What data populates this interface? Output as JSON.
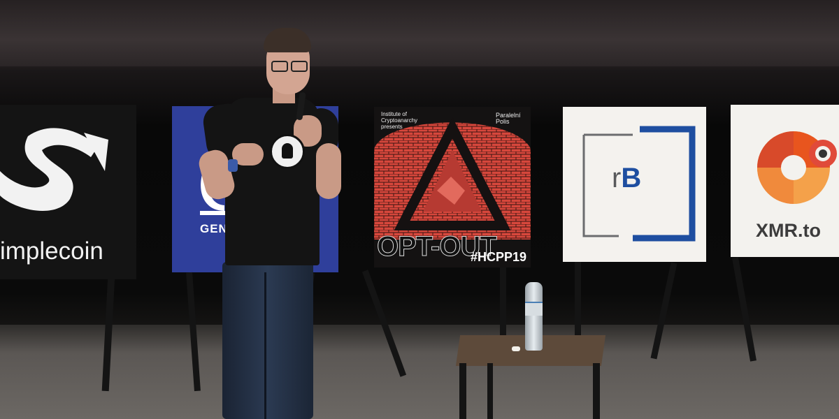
{
  "signs": {
    "simplecoin": {
      "wordmark": "implecoin",
      "color": "#141414"
    },
    "genesis": {
      "partial_text": "GEN",
      "color": "#2f3f9b"
    },
    "optout": {
      "presenter_left": "Institute of Cryptoanarchy",
      "presents": "presents",
      "presenter_right": "Paralelní Polis",
      "title": "OPT-OUT",
      "hashtag": "#HCPP19",
      "accent": "#d7473c"
    },
    "rb": {
      "letters_r": "r",
      "letters_b": "B",
      "accent": "#1e4ea0"
    },
    "xmr": {
      "wordmark": "XMR.to",
      "accent": "#e8551e"
    }
  },
  "scene": {
    "shirt_badge_icon": "badge-icon"
  }
}
